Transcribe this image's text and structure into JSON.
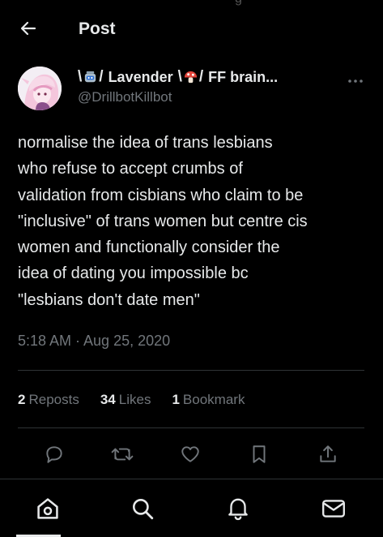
{
  "header": {
    "title": "Post",
    "cut_text": "g"
  },
  "post": {
    "emoticon_left": "\\",
    "emoticon_right": "/",
    "display_name": "Lavender",
    "display_name_tail": "FF brain...",
    "handle": "@DrillbotKillbot",
    "text": "normalise the idea of trans lesbians\nwho refuse to accept crumbs of\nvalidation from cisbians who claim to be\n\"inclusive\" of trans women but centre cis\nwomen and functionally consider the\nidea of dating you impossible bc\n\"lesbians don't date men\"",
    "timestamp": "5:18 AM · Aug 25, 2020"
  },
  "stats": {
    "reposts_count": "2",
    "reposts_label": "Reposts",
    "likes_count": "34",
    "likes_label": "Likes",
    "bookmarks_count": "1",
    "bookmarks_label": "Bookmark"
  },
  "icons": {
    "back": "arrow-left-icon",
    "more": "more-icon",
    "reply": "reply-icon",
    "repost": "repost-icon",
    "like": "heart-icon",
    "bookmark": "bookmark-icon",
    "share": "share-icon",
    "home": "home-icon",
    "search": "search-icon",
    "notifications": "bell-icon",
    "messages": "mail-icon"
  },
  "colors": {
    "background": "#000000",
    "text": "#e7e9ea",
    "muted": "#71767b",
    "divider": "#2f3336"
  }
}
